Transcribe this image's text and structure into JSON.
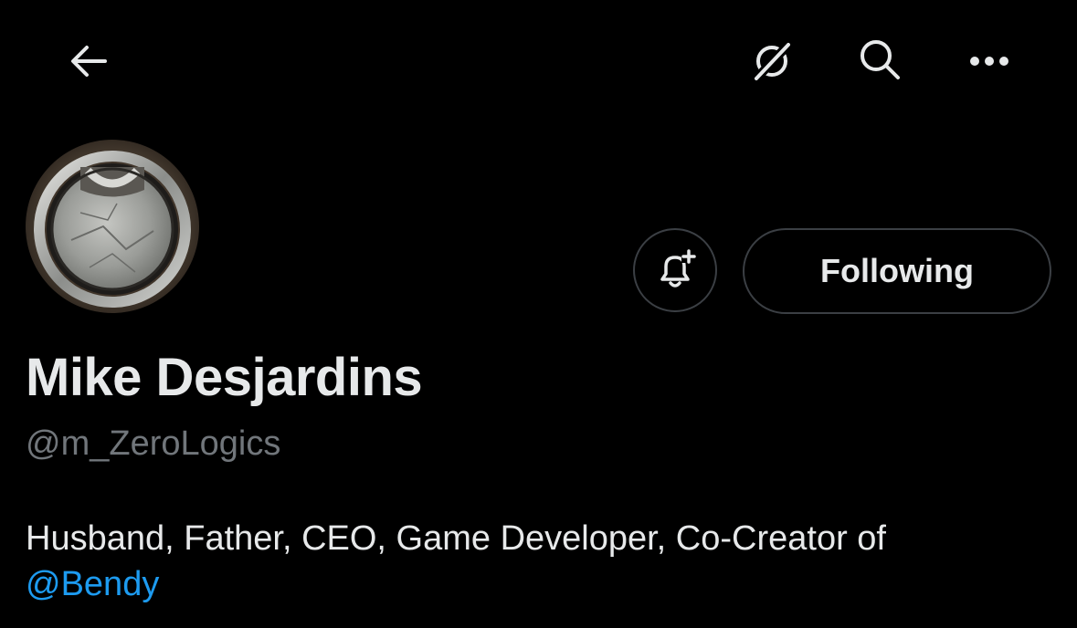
{
  "header": {
    "icons": [
      "back-arrow-icon",
      "grok-icon",
      "search-icon",
      "more-icon"
    ]
  },
  "profile": {
    "display_name": "Mike Desjardins",
    "handle": "@m_ZeroLogics",
    "bio_text": "Husband, Father, CEO, Game Developer, Co-Creator of",
    "bio_mention": "@Bendy"
  },
  "actions": {
    "notify_icon": "bell-plus-icon",
    "following_label": "Following"
  },
  "colors": {
    "background": "#000000",
    "primary_text": "#e7e9ea",
    "secondary_text": "#71767b",
    "link": "#1d9bf0",
    "button_border": "#3b3f44"
  }
}
